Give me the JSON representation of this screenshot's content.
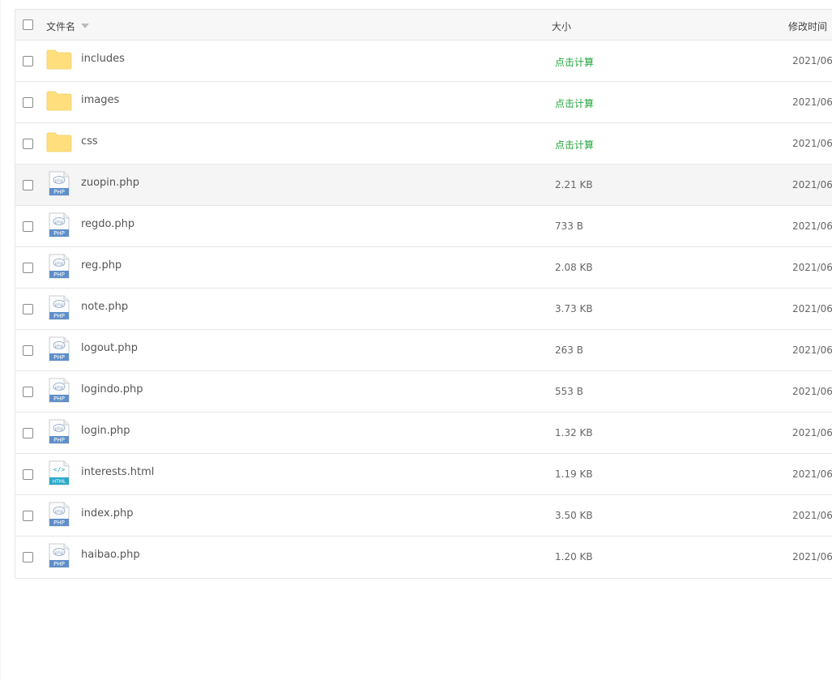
{
  "header": {
    "name_label": "文件名",
    "size_label": "大小",
    "mtime_label": "修改时间"
  },
  "rows": [
    {
      "name": "includes",
      "kind": "folder",
      "size": "点击计算",
      "mtime": "2021/06/"
    },
    {
      "name": "images",
      "kind": "folder",
      "size": "点击计算",
      "mtime": "2021/06/"
    },
    {
      "name": "css",
      "kind": "folder",
      "size": "点击计算",
      "mtime": "2021/06/"
    },
    {
      "name": "zuopin.php",
      "kind": "php",
      "size": "2.21 KB",
      "mtime": "2021/06/"
    },
    {
      "name": "regdo.php",
      "kind": "php",
      "size": "733 B",
      "mtime": "2021/06/"
    },
    {
      "name": "reg.php",
      "kind": "php",
      "size": "2.08 KB",
      "mtime": "2021/06/"
    },
    {
      "name": "note.php",
      "kind": "php",
      "size": "3.73 KB",
      "mtime": "2021/06/"
    },
    {
      "name": "logout.php",
      "kind": "php",
      "size": "263 B",
      "mtime": "2021/06/"
    },
    {
      "name": "logindo.php",
      "kind": "php",
      "size": "553 B",
      "mtime": "2021/06/"
    },
    {
      "name": "login.php",
      "kind": "php",
      "size": "1.32 KB",
      "mtime": "2021/06/"
    },
    {
      "name": "interests.html",
      "kind": "html",
      "size": "1.19 KB",
      "mtime": "2021/06/"
    },
    {
      "name": "index.php",
      "kind": "php",
      "size": "3.50 KB",
      "mtime": "2021/06/"
    },
    {
      "name": "haibao.php",
      "kind": "php",
      "size": "1.20 KB",
      "mtime": "2021/06/"
    }
  ],
  "icons": {
    "folder": "folder-icon",
    "php": "php-file-icon",
    "html": "html-file-icon",
    "php_badge": "PHP",
    "html_badge": "HTML"
  },
  "colors": {
    "calc_link": "#20a53a",
    "folder": "#ffdf7d",
    "php_badge": "#5f8fc9",
    "html_badge": "#2aa9c9"
  }
}
